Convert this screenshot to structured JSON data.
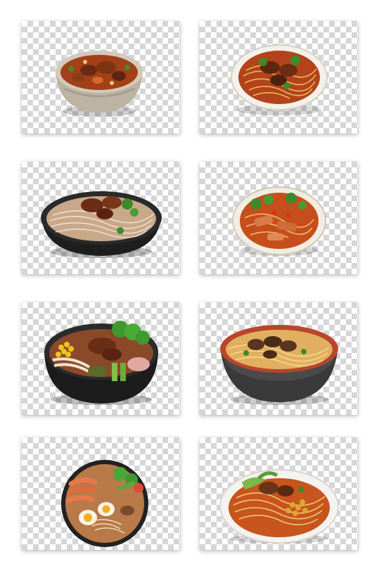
{
  "gallery": {
    "items": [
      {
        "dish": "beef-stew-soup-bowl",
        "bowl_color": "#bcb3a3"
      },
      {
        "dish": "braised-beef-noodles",
        "bowl_color": "#f4f1ea"
      },
      {
        "dish": "beef-rice-noodles-black-bowl",
        "bowl_color": "#1e1e1e"
      },
      {
        "dish": "spicy-pork-noodles",
        "bowl_color": "#f2ede2"
      },
      {
        "dish": "loaded-rice-noodle-bowl",
        "bowl_color": "#1c1c1c"
      },
      {
        "dish": "beef-noodle-soup-red-bowl",
        "bowl_color": "#b8462a"
      },
      {
        "dish": "seafood-ramen-with-egg",
        "bowl_color": "#222222"
      },
      {
        "dish": "soybean-beef-noodles",
        "bowl_color": "#f4f3ef"
      }
    ]
  }
}
